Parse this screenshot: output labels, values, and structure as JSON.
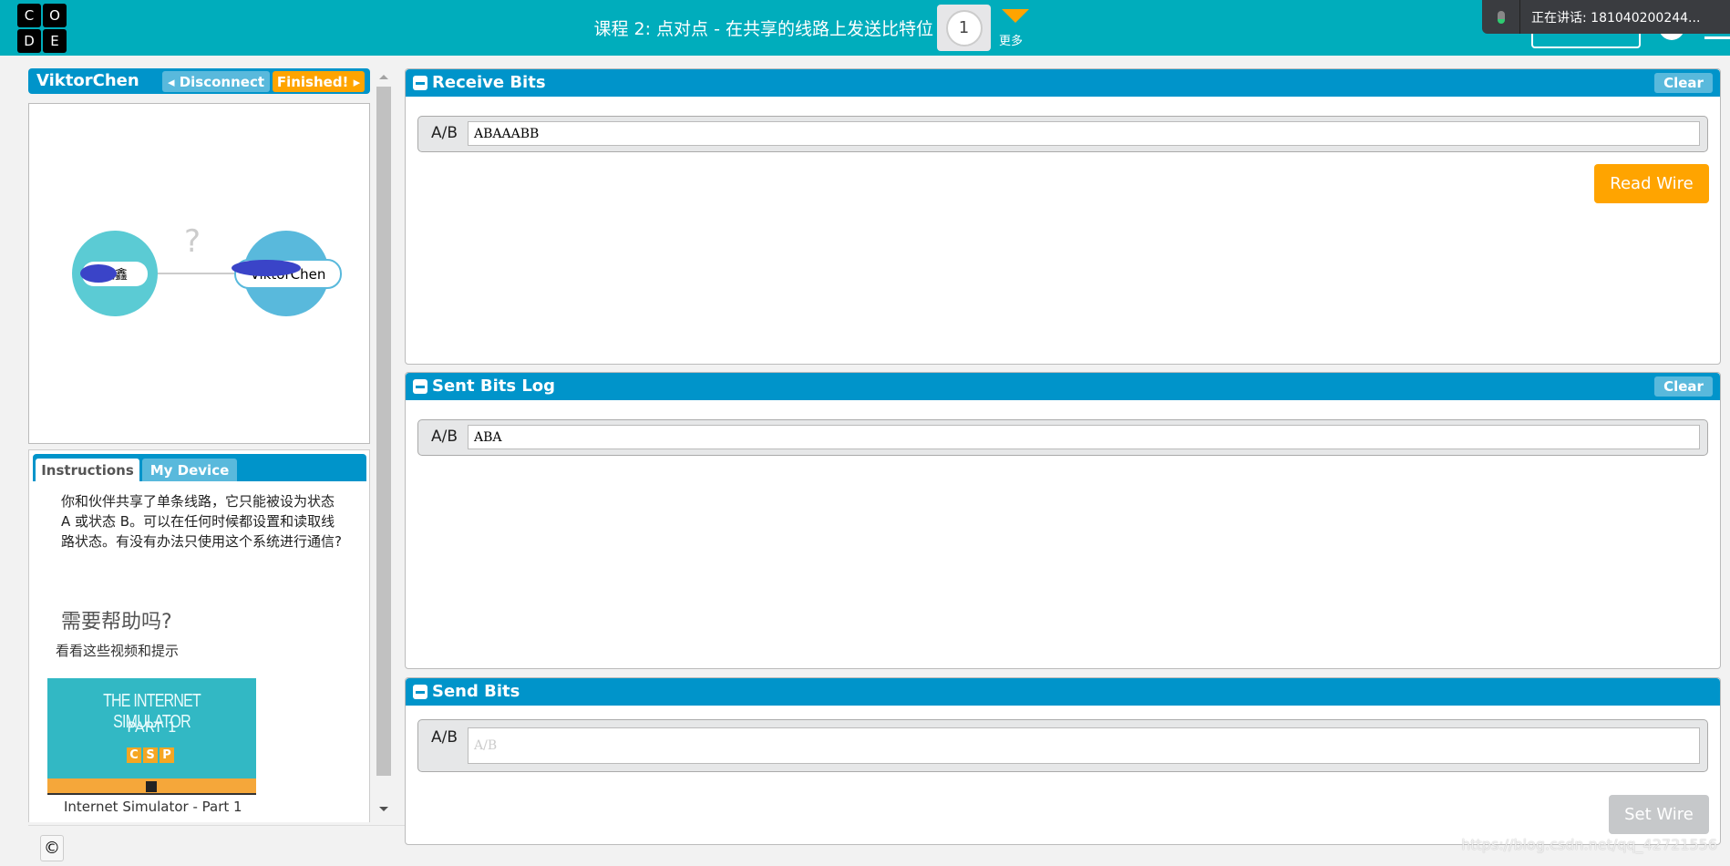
{
  "header": {
    "logo_letters": [
      "C",
      "O",
      "D",
      "E"
    ],
    "title": "课程 2: 点对点 - 在共享的线路上发送比特位",
    "level_number": "1",
    "more_label": "更多"
  },
  "overlay": {
    "speaking_text": "正在讲话: 181040200244..."
  },
  "left_panel": {
    "username": "ViktorChen",
    "disconnect_label": "Disconnect",
    "finished_label": "Finished!",
    "diagram": {
      "left_node_label": "王鑫",
      "right_node_label": "ViktorChen",
      "connection_symbol": "?",
      "left_node_color": "#5bcbd4",
      "right_node_color": "#59b9dc"
    },
    "tabs": [
      {
        "label": "Instructions",
        "active": true
      },
      {
        "label": "My Device",
        "active": false
      }
    ],
    "instructions": "你和伙伴共享了单条线路，它只能被设为状态 A 或状态 B。可以在任何时候都设置和读取线路状态。有没有办法只使用这个系统进行通信?",
    "help_heading": "需要帮助吗?",
    "help_subtitle": "看看这些视频和提示",
    "video": {
      "thumb_title": "THE INTERNET SIMULATOR",
      "thumb_part": "PART 1",
      "thumb_badge": [
        "C",
        "S",
        "P"
      ],
      "caption": "Internet Simulator - Part 1"
    },
    "copyright_symbol": "©"
  },
  "panels": {
    "receive": {
      "title": "Receive Bits",
      "clear_label": "Clear",
      "row_label": "A/B",
      "value": "ABAAABB",
      "read_wire_label": "Read Wire"
    },
    "sent_log": {
      "title": "Sent Bits Log",
      "clear_label": "Clear",
      "row_label": "A/B",
      "value": "ABA"
    },
    "send": {
      "title": "Send Bits",
      "row_label": "A/B",
      "placeholder": "A/B",
      "value": "",
      "set_wire_label": "Set Wire"
    }
  },
  "watermark": "https://blog.csdn.net/qq_42721556",
  "colors": {
    "header": "#00adbc",
    "panel_header": "#0094ca",
    "accent": "#ffa400"
  }
}
